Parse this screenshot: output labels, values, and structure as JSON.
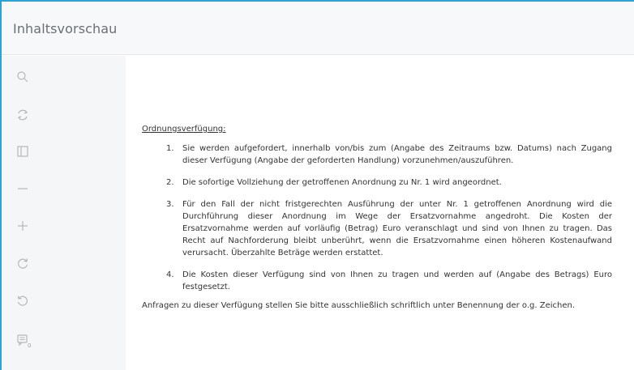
{
  "header": {
    "title": "Inhaltsvorschau"
  },
  "toolbar": {
    "items": [
      {
        "icon": "search-icon"
      },
      {
        "icon": "refresh-icon"
      },
      {
        "icon": "panel-icon"
      },
      {
        "icon": "zoom-out-icon"
      },
      {
        "icon": "zoom-in-icon"
      },
      {
        "icon": "rotate-right-icon"
      },
      {
        "icon": "rotate-left-icon"
      },
      {
        "icon": "comment-icon"
      }
    ],
    "comment_count": "0"
  },
  "document": {
    "heading": "Ordnungsverfügung:",
    "items": [
      {
        "number": "1.",
        "text": "Sie werden aufgefordert, innerhalb von/bis zum (Angabe des Zeitraums bzw. Datums) nach Zugang dieser Verfügung (Angabe der geforderten Handlung) vorzunehmen/auszuführen."
      },
      {
        "number": "2.",
        "text": "Die sofortige Vollziehung der getroffenen Anordnung zu Nr. 1 wird angeordnet."
      },
      {
        "number": "3.",
        "text": "Für den Fall der nicht fristgerechten Ausführung der unter Nr. 1 getroffenen Anordnung wird die Durchführung dieser Anordnung im Wege der Ersatzvornahme angedroht. Die Kosten der Ersatzvornahme werden auf vorläufig (Betrag) Euro veranschlagt und sind von Ihnen zu tragen. Das Recht auf Nachforderung bleibt unberührt, wenn die Ersatzvornahme einen höheren Kostenaufwand verursacht. Überzahlte Beträge werden erstattet."
      },
      {
        "number": "4.",
        "text": "Die Kosten dieser Verfügung sind von Ihnen zu tragen und werden auf (Angabe des Betrags) Euro festgesetzt."
      }
    ],
    "footer": "Anfragen zu dieser Verfügung stellen Sie bitte ausschließlich schriftlich unter Benennung der o.g. Zeichen."
  }
}
